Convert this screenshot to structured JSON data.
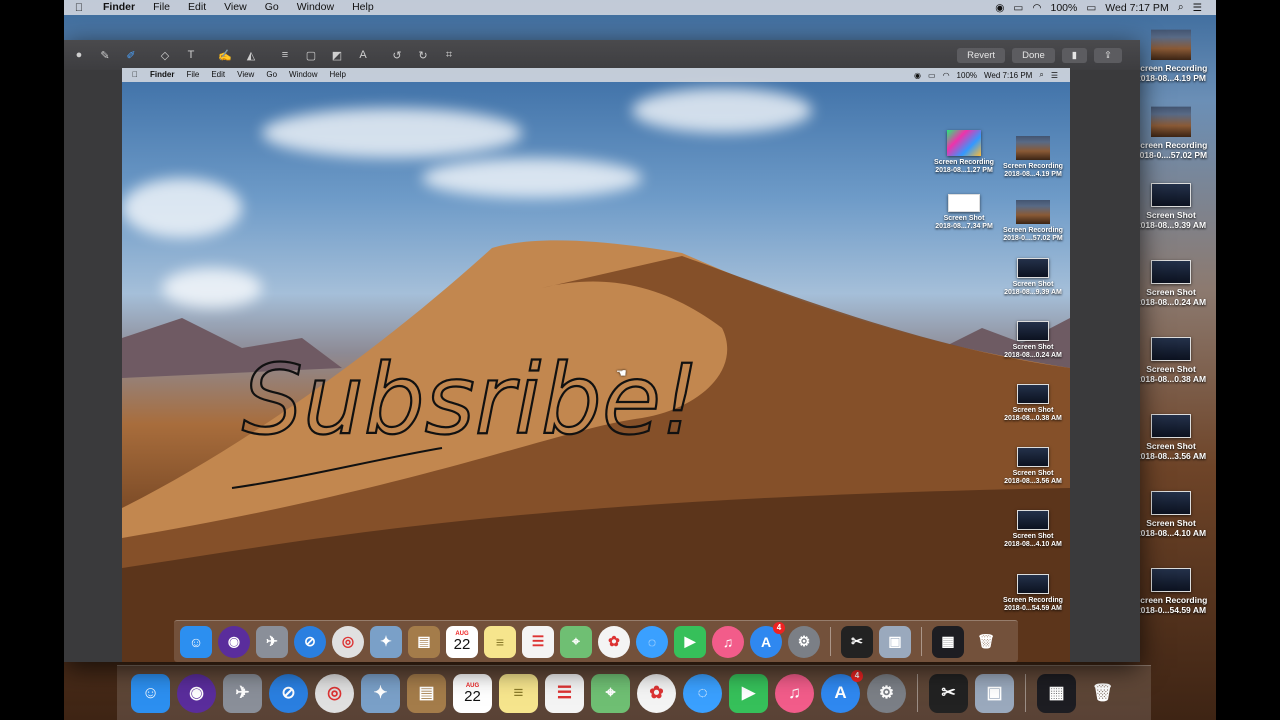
{
  "menubar": {
    "app": "Finder",
    "items": [
      "File",
      "Edit",
      "View",
      "Go",
      "Window",
      "Help"
    ],
    "battery": "100%",
    "clock": "Wed 7:17 PM"
  },
  "preview_toolbar": {
    "revert": "Revert",
    "done": "Done"
  },
  "inner_menubar": {
    "app": "Finder",
    "items": [
      "File",
      "Edit",
      "View",
      "Go",
      "Window",
      "Help"
    ],
    "battery": "100%",
    "clock": "Wed 7:16 PM"
  },
  "handwriting": "Subsribe!",
  "outer_desktop_icons": [
    {
      "line1": "Screen Recording",
      "line2": "2018-08...4.19 PM",
      "kind": "rec"
    },
    {
      "line1": "Screen Recording",
      "line2": "2018-0....57.02 PM",
      "kind": "rec"
    },
    {
      "line1": "Screen Shot",
      "line2": "2018-08...9.39 AM",
      "kind": "shot"
    },
    {
      "line1": "Screen Shot",
      "line2": "2018-08...0.24 AM",
      "kind": "shot"
    },
    {
      "line1": "Screen Shot",
      "line2": "2018-08...0.38 AM",
      "kind": "shot"
    },
    {
      "line1": "Screen Shot",
      "line2": "2018-08...3.56 AM",
      "kind": "shot"
    },
    {
      "line1": "Screen Shot",
      "line2": "2018-08...4.10 AM",
      "kind": "shot"
    },
    {
      "line1": "Screen Recording",
      "line2": "2018-0...54.59 AM",
      "kind": "shot"
    }
  ],
  "inner_desktop_icons": [
    {
      "line1": "Screen Recording",
      "line2": "2018-08...1.27 PM"
    },
    {
      "line1": "Screen Recording",
      "line2": "2018-08...4.19 PM"
    },
    {
      "line1": "Screen Shot",
      "line2": "2018-08...7.34 PM"
    },
    {
      "line1": "Screen Recording",
      "line2": "2018-0....57.02 PM"
    },
    {
      "line1": "Screen Shot",
      "line2": "2018-08...9.39 AM"
    },
    {
      "line1": "Screen Shot",
      "line2": "2018-08...0.24 AM"
    },
    {
      "line1": "Screen Shot",
      "line2": "2018-08...0.38 AM"
    },
    {
      "line1": "Screen Shot",
      "line2": "2018-08...3.56 AM"
    },
    {
      "line1": "Screen Shot",
      "line2": "2018-08...4.10 AM"
    },
    {
      "line1": "Screen Recording",
      "line2": "2018-0...54.59 AM"
    }
  ],
  "dock": {
    "calendar_month": "AUG",
    "calendar_day": "22",
    "appstore_badge": "4",
    "apps": [
      {
        "name": "finder",
        "color": "#2c8ff0",
        "glyph": "☺"
      },
      {
        "name": "siri",
        "color": "#5a2d9c",
        "glyph": "◉"
      },
      {
        "name": "launchpad",
        "color": "#8a8f99",
        "glyph": "✈"
      },
      {
        "name": "safari",
        "color": "#2a7fe0",
        "glyph": "⊘"
      },
      {
        "name": "chrome",
        "color": "#e0e0e0",
        "glyph": "◎"
      },
      {
        "name": "preview",
        "color": "#7aa0c8",
        "glyph": "✦"
      },
      {
        "name": "contacts",
        "color": "#a47c4a",
        "glyph": "▤"
      },
      {
        "name": "calendar",
        "color": "#ffffff",
        "glyph": ""
      },
      {
        "name": "notes",
        "color": "#f6e58d",
        "glyph": "≡"
      },
      {
        "name": "reminders",
        "color": "#f4f4f4",
        "glyph": "☰"
      },
      {
        "name": "maps",
        "color": "#6fbf73",
        "glyph": "⌖"
      },
      {
        "name": "photos",
        "color": "#f4f4f4",
        "glyph": "✿"
      },
      {
        "name": "messages",
        "color": "#3aa0ff",
        "glyph": "◌"
      },
      {
        "name": "facetime",
        "color": "#36c05a",
        "glyph": "▶"
      },
      {
        "name": "itunes",
        "color": "#f25c8a",
        "glyph": "♫"
      },
      {
        "name": "app-store",
        "color": "#2f88f0",
        "glyph": "A"
      },
      {
        "name": "system-preferences",
        "color": "#7b7f86",
        "glyph": "⚙"
      }
    ],
    "extras": [
      {
        "name": "final-cut-pro",
        "color": "#222",
        "glyph": "✂"
      },
      {
        "name": "image-capture",
        "color": "#9aa9bd",
        "glyph": "▣"
      }
    ],
    "trash_glyph": "🗑"
  }
}
